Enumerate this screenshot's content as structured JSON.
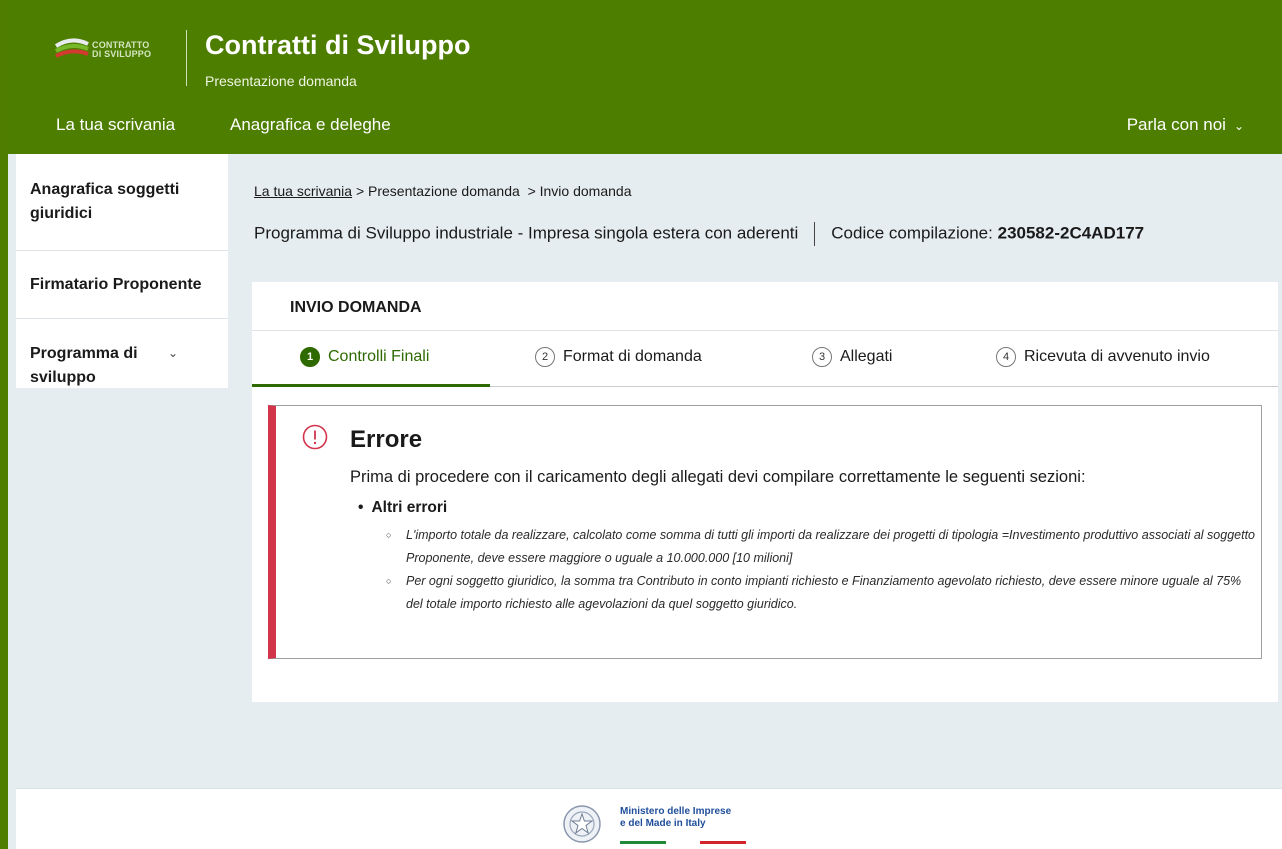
{
  "header": {
    "logo_text_line1": "CONTRATTO",
    "logo_text_line2": "DI SVILUPPO",
    "title": "Contratti di Sviluppo",
    "subtitle": "Presentazione domanda",
    "nav": [
      "La tua scrivania",
      "Anagrafica e deleghe"
    ],
    "nav_right": "Parla con noi",
    "brand_color": "#4e7e00"
  },
  "sidebar": {
    "items": [
      {
        "label": "Anagrafica soggetti giuridici"
      },
      {
        "label": "Firmatario Proponente"
      },
      {
        "label": "Programma di sviluppo"
      }
    ]
  },
  "breadcrumb": {
    "link": "La tua scrivania",
    "rest": " > Presentazione domanda  > Invio domanda"
  },
  "program": {
    "text": "Programma di Sviluppo industriale  -  Impresa singola estera con aderenti",
    "code_label": "Codice compilazione:",
    "code_value": "230582-2C4AD177"
  },
  "card": {
    "title": "INVIO DOMANDA",
    "steps": [
      {
        "num": "1",
        "label": "Controlli Finali",
        "active": true
      },
      {
        "num": "2",
        "label": "Format di domanda",
        "active": false
      },
      {
        "num": "3",
        "label": "Allegati",
        "active": false
      },
      {
        "num": "4",
        "label": "Ricevuta di avvenuto invio",
        "active": false
      }
    ]
  },
  "alert": {
    "icon": "alert-circle-icon",
    "title": "Errore",
    "message": "Prima di procedere con il caricamento degli allegati devi compilare correttamente le seguenti sezioni:",
    "section": "Altri errori",
    "errors": [
      "L'importo totale da realizzare, calcolato come somma di tutti gli importi da realizzare dei progetti di tipologia =Investimento produttivo associati al soggetto Proponente, deve essere maggiore o uguale a 10.000.000 [10 milioni]",
      "Per ogni soggetto giuridico, la somma tra Contributo in conto impianti richiesto e Finanziamento agevolato richiesto, deve essere minore uguale al 75% del totale importo richiesto alle agevolazioni da quel soggetto giuridico."
    ],
    "accent_color": "#d1344b"
  },
  "footer": {
    "line1": "Ministero delle Imprese",
    "line2": "e del Made in Italy"
  }
}
